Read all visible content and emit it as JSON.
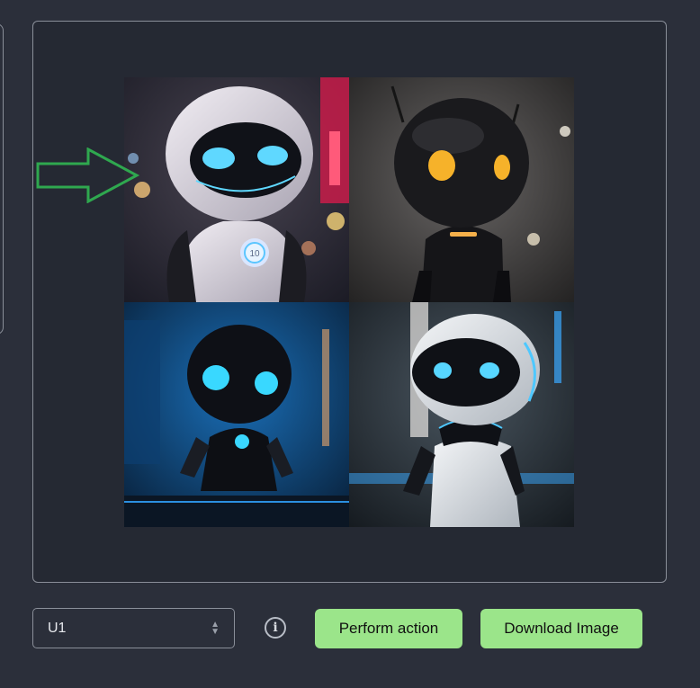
{
  "variant_select": {
    "value": "U1"
  },
  "info": {
    "glyph": "i"
  },
  "buttons": {
    "perform_label": "Perform action",
    "download_label": "Download Image"
  },
  "image_grid": {
    "badge_text": "10",
    "cells": [
      {
        "icon": "robot-white-top-left"
      },
      {
        "icon": "robot-black-orange-eyes"
      },
      {
        "icon": "robot-black-blue-eyes"
      },
      {
        "icon": "robot-white-blue-eyes"
      }
    ]
  },
  "colors": {
    "accent_green": "#9be58a",
    "arrow": "#2fa84f",
    "bg": "#2b2f3a"
  }
}
